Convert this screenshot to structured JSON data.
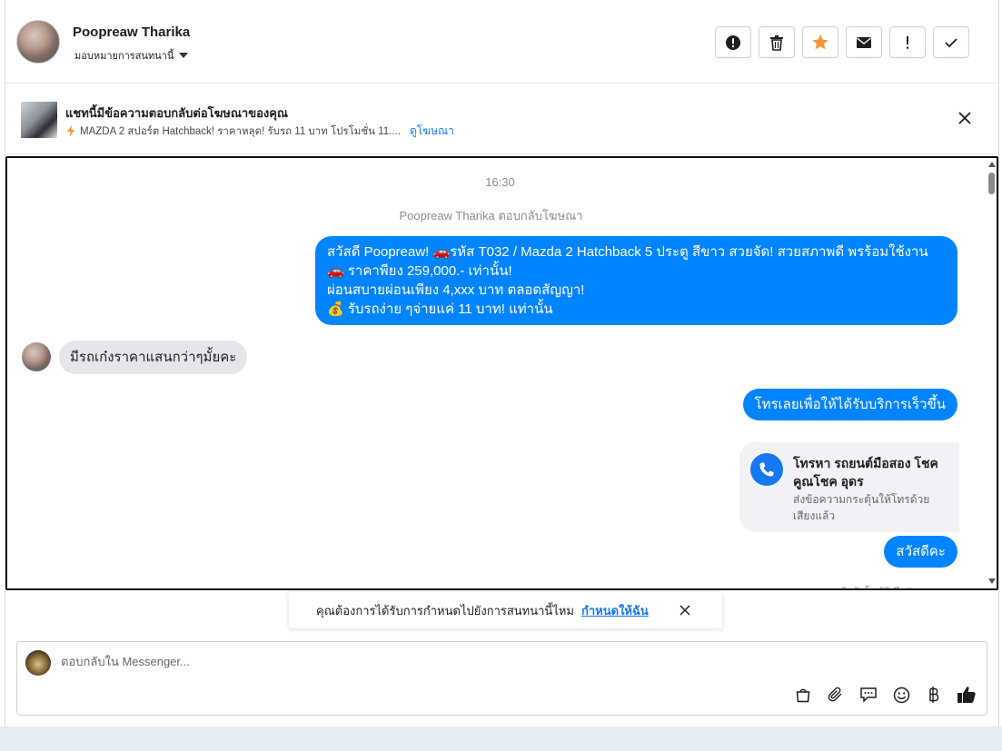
{
  "header": {
    "contact_name": "Poopreaw Tharika",
    "assign_label": "มอบหมายการสนทนานี้"
  },
  "ad_banner": {
    "title": "แชทนี้มีข้อความตอบกลับต่อโฆษณาของคุณ",
    "ad_text": "MAZDA 2 สปอร์ต Hatchback! ราคาหลุด! รับรถ 11 บาท โปรโมชั่น 11....",
    "view_ad_label": "ดูโฆษณา"
  },
  "chat": {
    "timestamp": "16:30",
    "replied_notice": "Poopreaw Tharika ตอบกลับโฆษณา",
    "messages": [
      {
        "direction": "out",
        "lines": [
          "สวัสดี Poopreaw! 🚗รหัส T032 /  Mazda 2 Hatchback 5 ประตู สีขาว สวยจัด! สวยสภาพดี พรร้อมใช้งาน",
          "🚗 ราคาพียง 259,000.- เท่านั้น!",
          "ผ่อนสบายผ่อนเพียง 4,xxx บาท ตลอดสัญญา!",
          "💰 รับรถง่าย ๆจ่ายแค่ 11 บาท! แท่านั้น"
        ]
      },
      {
        "direction": "in",
        "text": "มีรถเก๋งราคาแสนกว่าๆมั้ยคะ"
      },
      {
        "direction": "out",
        "text": "โทรเลยเพื่อให้ได้รับบริการเร็วขึ้น"
      },
      {
        "direction": "out",
        "type": "call_card",
        "title": "โทรหา รถยนต์มือสอง โชคคูณโชค อุดร",
        "subtitle": "ส่งข้อความกระตุ้นให้โทรด้วยเสียงแล้ว"
      },
      {
        "direction": "out",
        "text": "สวัสดีคะ"
      }
    ],
    "cutoff_text": "ถูกตอบกลับอัตโนมัติ ถึง Poopreaw"
  },
  "assign_prompt": {
    "text": "คุณต้องการได้รับการกำหนดไปยังการสนทนานี้ไหม",
    "action_label": "กำหนดให้ฉัน"
  },
  "composer": {
    "placeholder": "ตอบกลับใน Messenger..."
  },
  "colors": {
    "outgoing_bubble": "#0084ff",
    "incoming_bubble": "#e4e6eb",
    "link": "#1877f2",
    "star": "#f7923a"
  }
}
